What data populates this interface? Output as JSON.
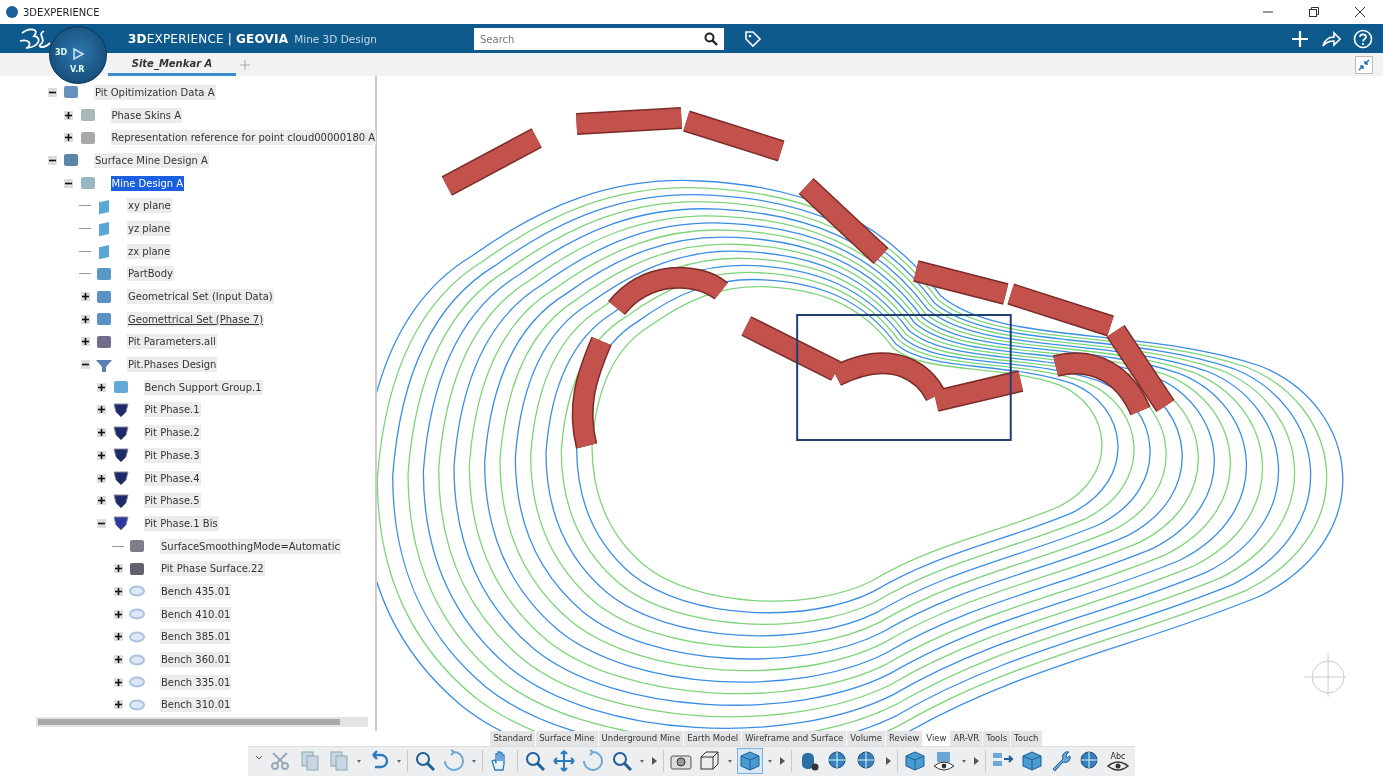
{
  "window": {
    "title": "3DEXPERIENCE"
  },
  "header": {
    "brand": "**3D**EXPERIENCE | **GEOVIA**",
    "app": "Mine 3D Design",
    "compass": {
      "left": "3D",
      "bottom": "V.R"
    },
    "search": {
      "placeholder": "Search"
    }
  },
  "tabs": [
    {
      "label": "Site_Menkar A",
      "selected": true
    }
  ],
  "tree": [
    {
      "label": "Pit Opitimization Data A",
      "kind": "data",
      "expanded": true,
      "children": [
        {
          "label": "Phase Skins A",
          "kind": "skin",
          "expanded": false
        },
        {
          "label": "Representation reference for point cloud00000180 A",
          "kind": "cloud",
          "expanded": false
        }
      ]
    },
    {
      "label": "Surface Mine Design A",
      "kind": "mine",
      "expanded": true,
      "children": [
        {
          "label": "Mine Design A",
          "kind": "part",
          "expanded": true,
          "selected": true,
          "children": [
            {
              "label": "xy plane",
              "kind": "plane"
            },
            {
              "label": "yz plane",
              "kind": "plane"
            },
            {
              "label": "zx plane",
              "kind": "plane"
            },
            {
              "label": "PartBody",
              "kind": "body"
            },
            {
              "label": "Geometrical Set (Input Data)",
              "kind": "set",
              "expanded": false
            },
            {
              "label": "Geomettrical Set (Phase 7)",
              "kind": "set",
              "expanded": false,
              "underlined": true
            },
            {
              "label": "Pit Parameters.all",
              "kind": "params",
              "expanded": false
            },
            {
              "label": "Pit.Phases Design",
              "kind": "funnel",
              "expanded": true,
              "children": [
                {
                  "label": "Bench Support Group.1",
                  "kind": "support",
                  "expanded": false
                },
                {
                  "label": "Pit Phase.1",
                  "kind": "phase",
                  "expanded": false
                },
                {
                  "label": "Pit Phase.2",
                  "kind": "phase",
                  "expanded": false
                },
                {
                  "label": "Pit Phase.3",
                  "kind": "phase",
                  "expanded": false
                },
                {
                  "label": "Pit Phase.4",
                  "kind": "phase",
                  "expanded": false
                },
                {
                  "label": "Pit Phase.5",
                  "kind": "phase",
                  "expanded": false
                },
                {
                  "label": "Pit Phase.1 Bis",
                  "kind": "shield",
                  "expanded": true,
                  "children": [
                    {
                      "label": "SurfaceSmoothingMode=Automatic",
                      "kind": "param"
                    },
                    {
                      "label": "Pit Phase Surface.22",
                      "kind": "surface",
                      "expanded": false
                    },
                    {
                      "label": "Bench 435.01",
                      "kind": "bench",
                      "expanded": false
                    },
                    {
                      "label": "Bench 410.01",
                      "kind": "bench",
                      "expanded": false
                    },
                    {
                      "label": "Bench 385.01",
                      "kind": "bench",
                      "expanded": false
                    },
                    {
                      "label": "Bench 360.01",
                      "kind": "bench",
                      "expanded": false
                    },
                    {
                      "label": "Bench 335.01",
                      "kind": "bench",
                      "expanded": false
                    },
                    {
                      "label": "Bench 310.01",
                      "kind": "bench",
                      "expanded": false
                    }
                  ]
                }
              ]
            }
          ]
        }
      ]
    }
  ],
  "action_tabs": [
    {
      "label": "Standard",
      "selected": false
    },
    {
      "label": "Surface Mine",
      "selected": false
    },
    {
      "label": "Underground Mine",
      "selected": false
    },
    {
      "label": "Earth Model",
      "selected": false
    },
    {
      "label": "Wireframe and Surface",
      "selected": false
    },
    {
      "label": "Volume",
      "selected": false
    },
    {
      "label": "Review",
      "selected": false
    },
    {
      "label": "View",
      "selected": true
    },
    {
      "label": "AR-VR",
      "selected": false
    },
    {
      "label": "Tools",
      "selected": false
    },
    {
      "label": "Touch",
      "selected": false
    }
  ],
  "toolbar": {
    "abc_label": "Abc"
  }
}
